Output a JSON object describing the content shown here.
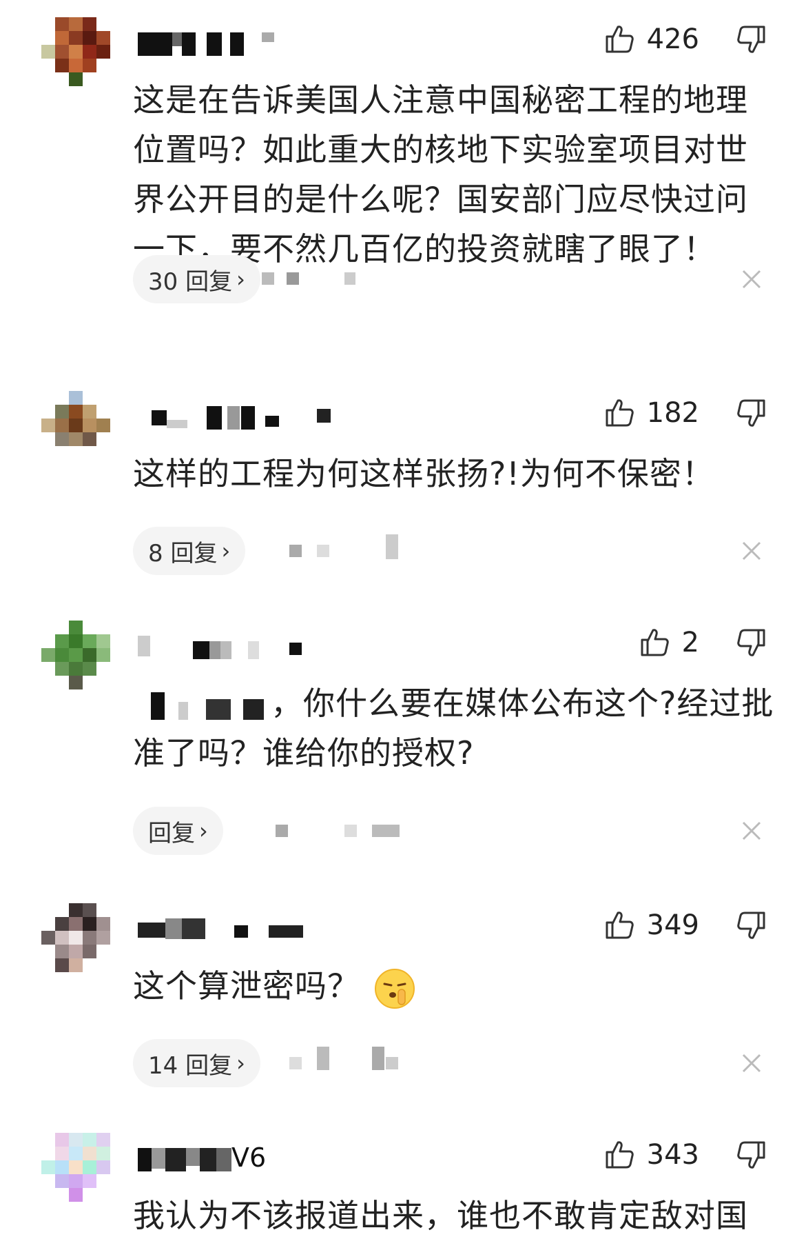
{
  "comments": [
    {
      "likes": "426",
      "text": "这是在告诉美国人注意中国秘密工程的地理位置吗？如此重大的核地下实验室项目对世界公开目的是什么呢？国安部门应尽快过问一下，要不然几百亿的投资就瞎了眼了！",
      "reply_label": "30 回复"
    },
    {
      "likes": "182",
      "text": "这样的工程为何这样张扬?!为何不保密！",
      "reply_label": "8 回复"
    },
    {
      "likes": "2",
      "text_prefix": "，",
      "text": "你什么要在媒体公布这个?经过批准了吗？谁给你的授权?",
      "reply_label": "回复"
    },
    {
      "likes": "349",
      "text": "这个算泄密吗？",
      "emoji": "shushing-face-emoji",
      "reply_label": "14 回复"
    },
    {
      "likes": "343",
      "username_suffix": "V6",
      "text": "我认为不该报道出来，谁也不敢肯定敌对国"
    }
  ],
  "icons": {
    "like": "thumbs-up-icon",
    "dislike": "thumbs-down-icon",
    "reply_arrow": "chevron-right-icon",
    "close": "close-icon"
  },
  "colors": {
    "text": "#222222",
    "pill_bg": "#f4f4f4",
    "icon": "#333333",
    "close": "#bbbbbb"
  }
}
